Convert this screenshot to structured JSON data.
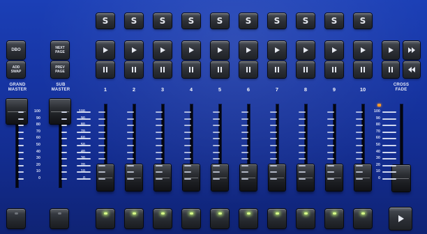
{
  "colors": {
    "panel": "#1736a6",
    "led_on": "#d9ff8a",
    "led_off": "#6f747b",
    "cross_led": "#ff9a28"
  },
  "left_keys": {
    "dbo": "DBO",
    "add_swap": [
      "ADD",
      "SWAP"
    ],
    "next_page": [
      "NEXT",
      "PAGE"
    ],
    "prev_page": [
      "PREV",
      "PAGE"
    ]
  },
  "labels": {
    "grand_master": [
      "GRAND",
      "MASTER"
    ],
    "sub_master": [
      "SUB",
      "MASTER"
    ],
    "cross_fade": [
      "CROSS",
      "FADE"
    ]
  },
  "select_key": "S",
  "playbacks": [
    {
      "num": "1",
      "flash_led": "on"
    },
    {
      "num": "2",
      "flash_led": "on"
    },
    {
      "num": "3",
      "flash_led": "on"
    },
    {
      "num": "4",
      "flash_led": "on"
    },
    {
      "num": "5",
      "flash_led": "on"
    },
    {
      "num": "6",
      "flash_led": "on"
    },
    {
      "num": "7",
      "flash_led": "on"
    },
    {
      "num": "8",
      "flash_led": "on"
    },
    {
      "num": "9",
      "flash_led": "on"
    },
    {
      "num": "10",
      "flash_led": "on"
    }
  ],
  "left_flash_keys": [
    {
      "led": "off"
    },
    {
      "led": "off"
    }
  ],
  "scale": [
    "100",
    "90",
    "80",
    "70",
    "60",
    "50",
    "40",
    "30",
    "20",
    "10",
    "0"
  ],
  "icons": {
    "play": "play-icon",
    "pause": "pause-icon",
    "fast_forward": "fast-forward-icon",
    "rewind": "rewind-icon",
    "go": "go-icon"
  }
}
